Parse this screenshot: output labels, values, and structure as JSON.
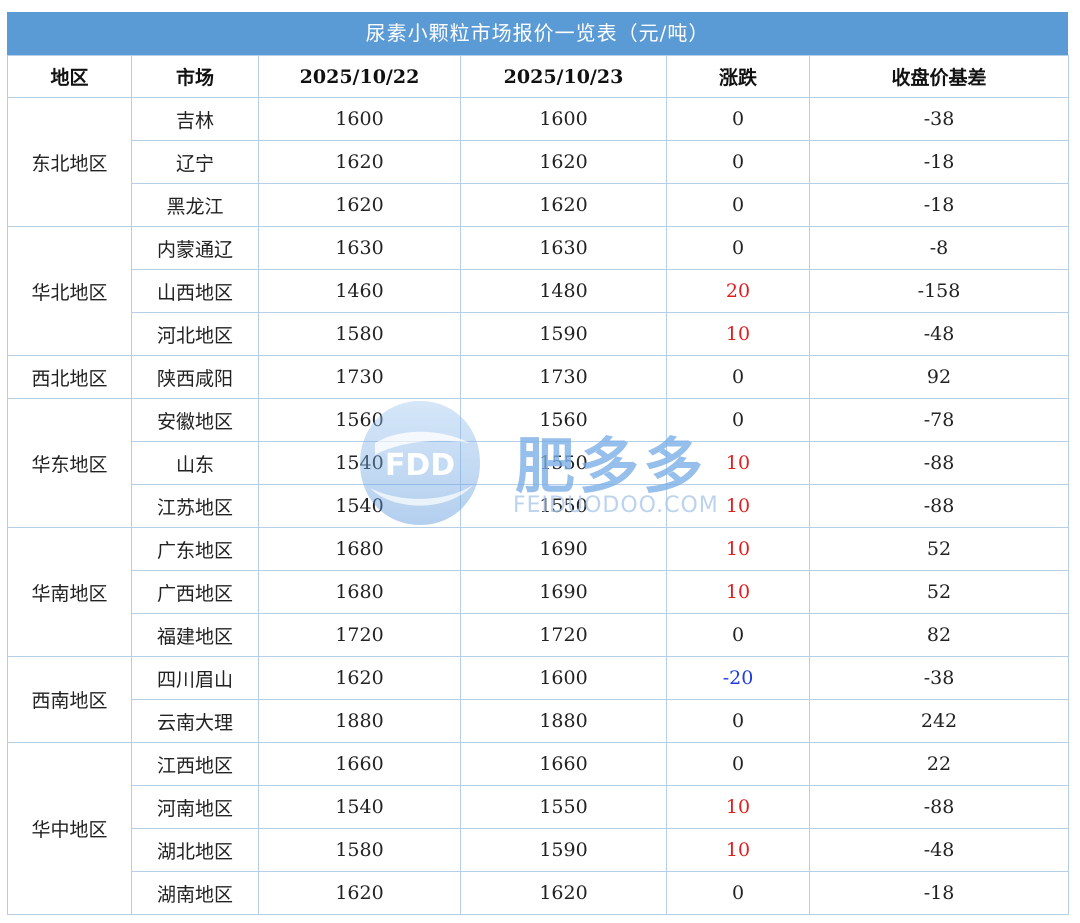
{
  "title": "尿素小颗粒市场报价一览表（元/吨）",
  "headers": [
    "地区",
    "市场",
    "2025/10/22",
    "2025/10/23",
    "涨跌",
    "收盘价基差"
  ],
  "groups": [
    {
      "region": "东北地区",
      "rows": [
        {
          "market": "吉林",
          "d1": "1600",
          "d2": "1600",
          "chg": "0",
          "basis": "-38"
        },
        {
          "market": "辽宁",
          "d1": "1620",
          "d2": "1620",
          "chg": "0",
          "basis": "-18"
        },
        {
          "market": "黑龙江",
          "d1": "1620",
          "d2": "1620",
          "chg": "0",
          "basis": "-18"
        }
      ]
    },
    {
      "region": "华北地区",
      "rows": [
        {
          "market": "内蒙通辽",
          "d1": "1630",
          "d2": "1630",
          "chg": "0",
          "basis": "-8"
        },
        {
          "market": "山西地区",
          "d1": "1460",
          "d2": "1480",
          "chg": "20",
          "basis": "-158"
        },
        {
          "market": "河北地区",
          "d1": "1580",
          "d2": "1590",
          "chg": "10",
          "basis": "-48"
        }
      ]
    },
    {
      "region": "西北地区",
      "rows": [
        {
          "market": "陕西咸阳",
          "d1": "1730",
          "d2": "1730",
          "chg": "0",
          "basis": "92"
        }
      ]
    },
    {
      "region": "华东地区",
      "rows": [
        {
          "market": "安徽地区",
          "d1": "1560",
          "d2": "1560",
          "chg": "0",
          "basis": "-78"
        },
        {
          "market": "山东",
          "d1": "1540",
          "d2": "1550",
          "chg": "10",
          "basis": "-88"
        },
        {
          "market": "江苏地区",
          "d1": "1540",
          "d2": "1550",
          "chg": "10",
          "basis": "-88"
        }
      ]
    },
    {
      "region": "华南地区",
      "rows": [
        {
          "market": "广东地区",
          "d1": "1680",
          "d2": "1690",
          "chg": "10",
          "basis": "52"
        },
        {
          "market": "广西地区",
          "d1": "1680",
          "d2": "1690",
          "chg": "10",
          "basis": "52"
        },
        {
          "market": "福建地区",
          "d1": "1720",
          "d2": "1720",
          "chg": "0",
          "basis": "82"
        }
      ]
    },
    {
      "region": "西南地区",
      "rows": [
        {
          "market": "四川眉山",
          "d1": "1620",
          "d2": "1600",
          "chg": "-20",
          "basis": "-38"
        },
        {
          "market": "云南大理",
          "d1": "1880",
          "d2": "1880",
          "chg": "0",
          "basis": "242"
        }
      ]
    },
    {
      "region": "华中地区",
      "rows": [
        {
          "market": "江西地区",
          "d1": "1660",
          "d2": "1660",
          "chg": "0",
          "basis": "22"
        },
        {
          "market": "河南地区",
          "d1": "1540",
          "d2": "1550",
          "chg": "10",
          "basis": "-88"
        },
        {
          "market": "湖北地区",
          "d1": "1580",
          "d2": "1590",
          "chg": "10",
          "basis": "-48"
        },
        {
          "market": "湖南地区",
          "d1": "1620",
          "d2": "1620",
          "chg": "0",
          "basis": "-18"
        }
      ]
    }
  ],
  "watermark": {
    "logo_text": "FDD",
    "brand": "肥多多",
    "domain": "FEIDUODOO.COM"
  },
  "colors": {
    "header_bg": "#5b9bd5",
    "up": "#e02020",
    "down": "#1f3de0",
    "border": "#b7cfe6"
  }
}
